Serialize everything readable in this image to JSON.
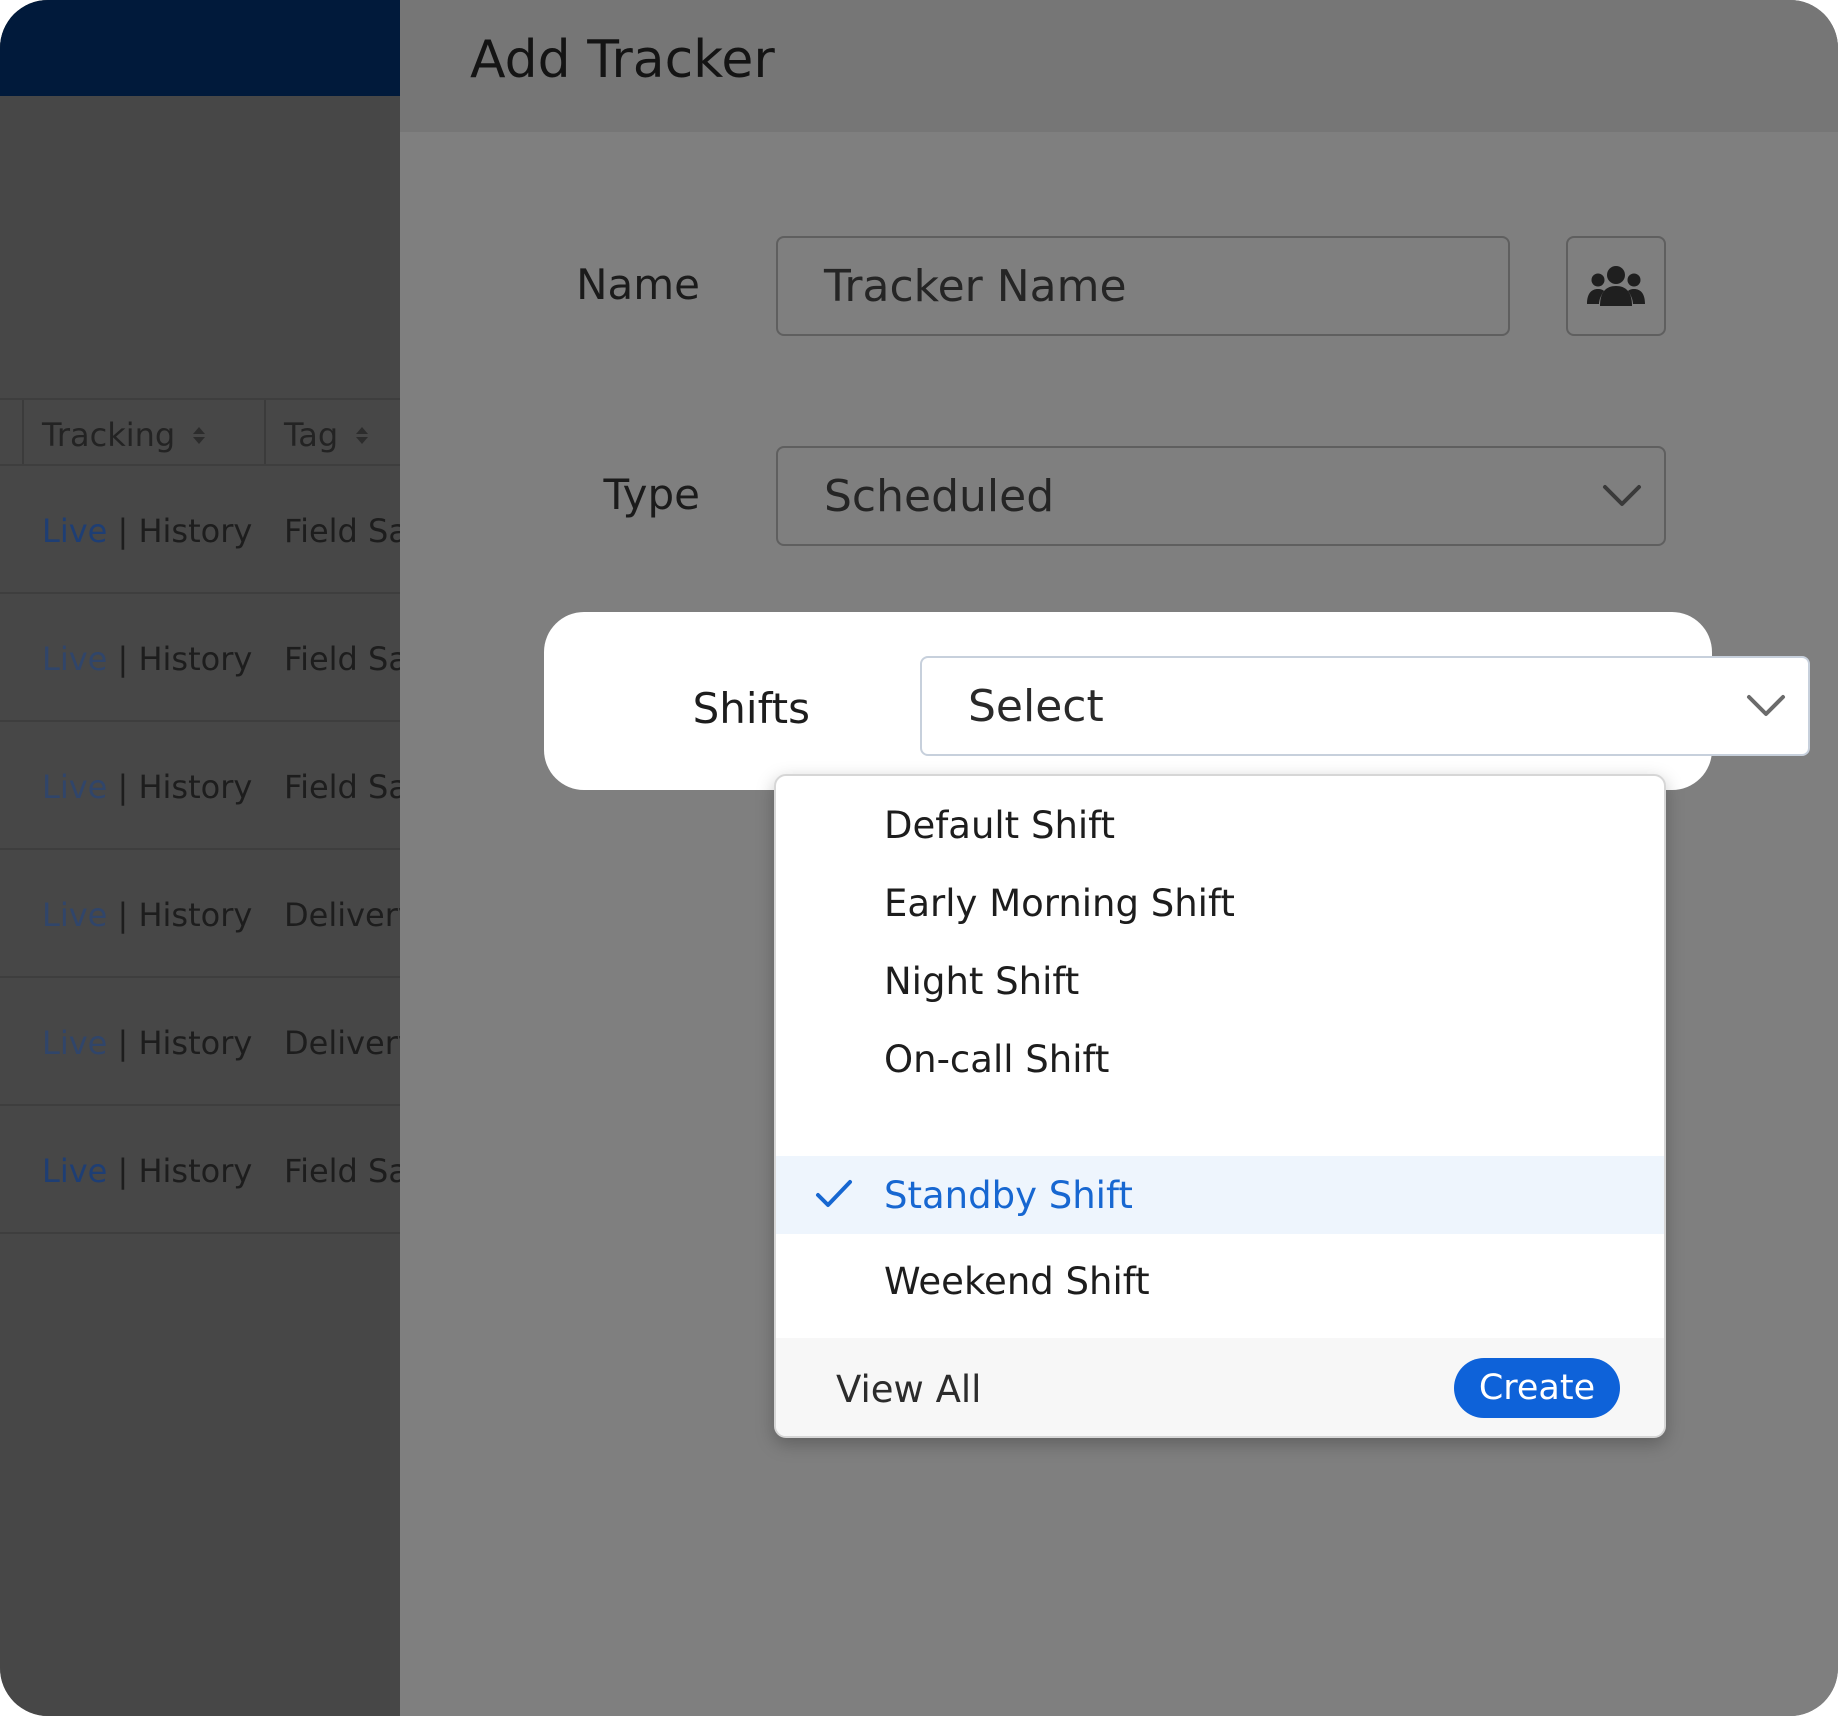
{
  "background": {
    "table": {
      "columns": [
        "Tracking",
        "Tag"
      ],
      "rows": [
        {
          "live": "Live",
          "history": "| History",
          "tag": "Field Sa"
        },
        {
          "live": "Live",
          "history": "| History",
          "tag": "Field Sa"
        },
        {
          "live": "Live",
          "history": "| History",
          "tag": "Field Sa"
        },
        {
          "live": "Live",
          "history": "| History",
          "tag": "Delivery"
        },
        {
          "live": "Live",
          "history": "| History",
          "tag": "Delivery"
        },
        {
          "live": "Live",
          "history": "| History",
          "tag": "Field Sa"
        }
      ]
    }
  },
  "drawer": {
    "title": "Add Tracker",
    "name": {
      "label": "Name",
      "value": "Tracker Name",
      "group_icon": "users-group-icon"
    },
    "type": {
      "label": "Type",
      "value": "Scheduled"
    },
    "shifts": {
      "label": "Shifts",
      "placeholder": "Select",
      "options": [
        {
          "label": "Default Shift",
          "selected": false
        },
        {
          "label": "Early Morning Shift",
          "selected": false
        },
        {
          "label": "Night Shift",
          "selected": false
        },
        {
          "label": "On-call Shift",
          "selected": false
        },
        {
          "label": "Standby Shift",
          "selected": true
        },
        {
          "label": "Weekend Shift",
          "selected": false
        }
      ],
      "footer": {
        "view_all": "View All",
        "create": "Create"
      }
    }
  },
  "colors": {
    "accent": "#0e62d9",
    "selected_text": "#1767d1",
    "selected_bg": "#eef5fd",
    "topbar": "#011a3b"
  }
}
